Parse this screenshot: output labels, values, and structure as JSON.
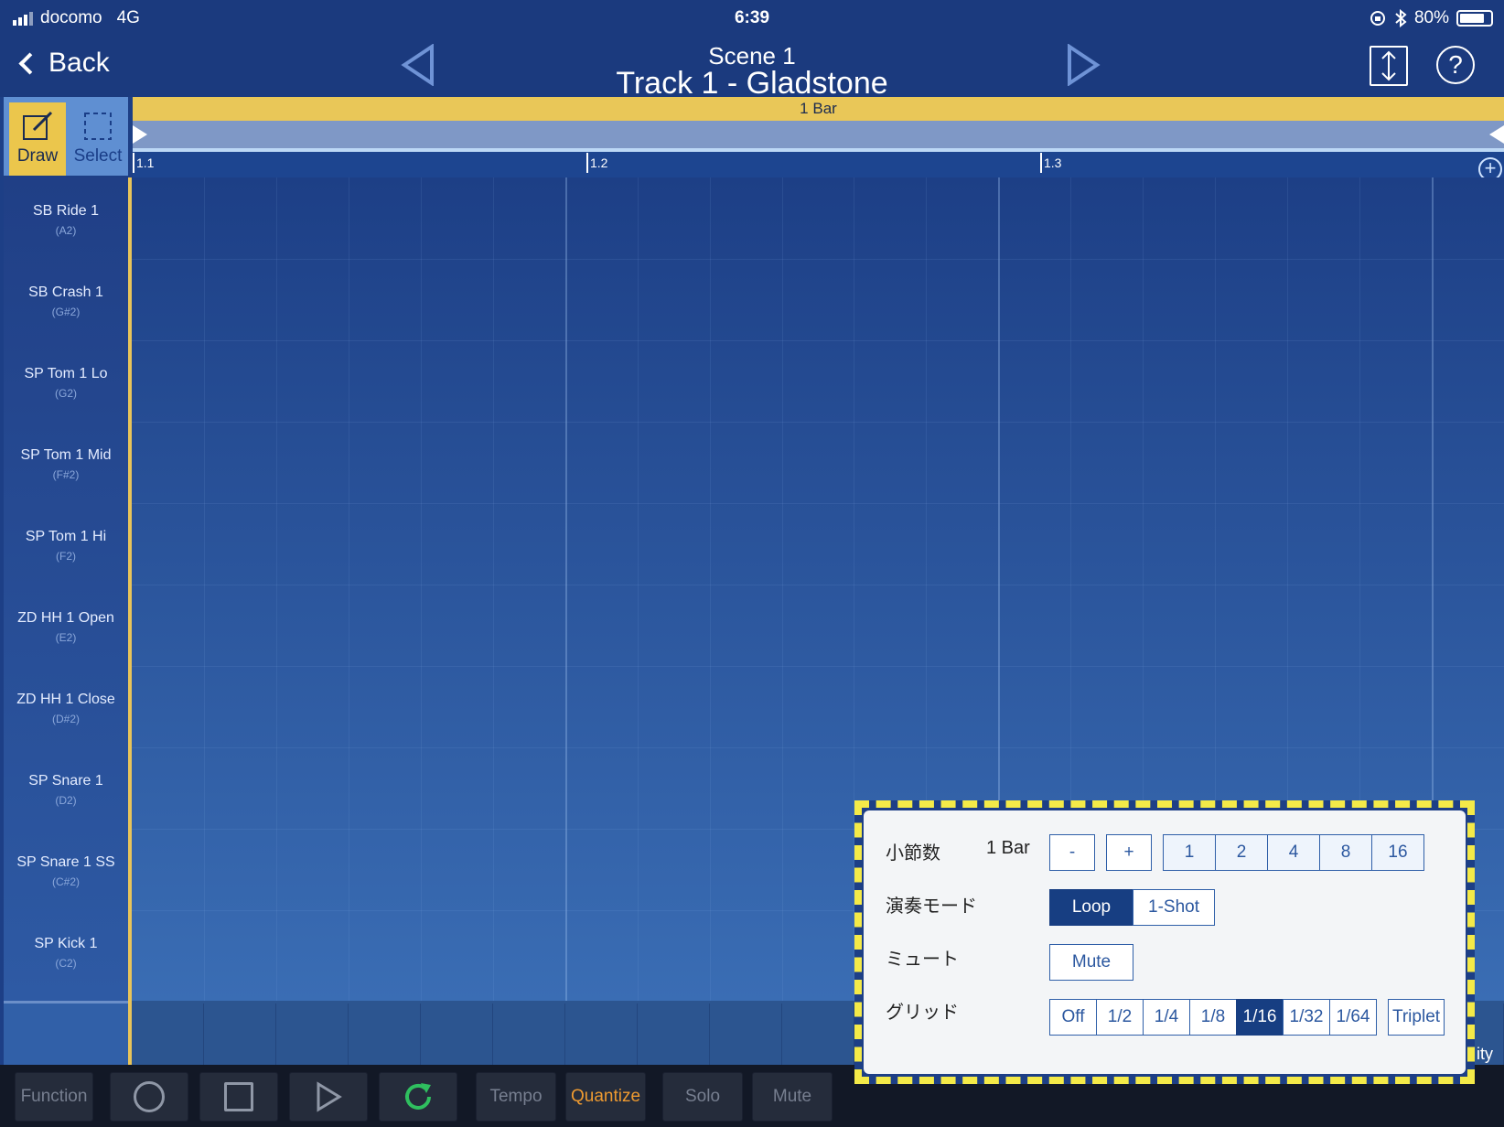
{
  "status": {
    "carrier": "docomo",
    "network": "4G",
    "time": "6:39",
    "battery": "80%",
    "battery_level": 0.8
  },
  "nav": {
    "back_label": "Back",
    "scene": "Scene  1",
    "track": "Track 1 - Gladstone"
  },
  "tools": {
    "draw_label": "Draw",
    "select_label": "Select",
    "active": "Draw"
  },
  "loop": {
    "length_label": "1 Bar"
  },
  "ruler": {
    "markers": [
      "1.1",
      "1.2",
      "1.3"
    ]
  },
  "lanes": [
    {
      "name": "SB Ride 1",
      "note": "(A2)"
    },
    {
      "name": "SB Crash 1",
      "note": "(G#2)"
    },
    {
      "name": "SP Tom 1 Lo",
      "note": "(G2)"
    },
    {
      "name": "SP Tom 1 Mid",
      "note": "(F#2)"
    },
    {
      "name": "SP Tom 1 Hi",
      "note": "(F2)"
    },
    {
      "name": "ZD HH 1 Open",
      "note": "(E2)"
    },
    {
      "name": "ZD HH 1 Close",
      "note": "(D#2)"
    },
    {
      "name": "SP Snare 1",
      "note": "(D2)"
    },
    {
      "name": "SP Snare 1 SS",
      "note": "(C#2)"
    },
    {
      "name": "SP Kick 1",
      "note": "(C2)"
    }
  ],
  "velocity_edge_label": "ity",
  "transport": {
    "function": "Function",
    "tempo": "Tempo",
    "quantize": "Quantize",
    "solo": "Solo",
    "mute": "Mute"
  },
  "popup": {
    "bars_label": "小節数",
    "bars_value": "1 Bar",
    "minus": "-",
    "plus": "+",
    "bar_options": [
      "1",
      "2",
      "4",
      "8",
      "16"
    ],
    "mode_label": "演奏モード",
    "mode_options": [
      "Loop",
      "1-Shot"
    ],
    "mode_selected": "Loop",
    "mute_label": "ミュート",
    "mute_button": "Mute",
    "grid_label": "グリッド",
    "grid_options": [
      "Off",
      "1/2",
      "1/4",
      "1/8",
      "1/16",
      "1/32",
      "1/64"
    ],
    "grid_selected": "1/16",
    "triplet": "Triplet"
  },
  "colors": {
    "background": "#1d3f86",
    "accent_yellow": "#e9c758",
    "selected_button": "#173e82",
    "quantize_active": "#ee9a30"
  }
}
